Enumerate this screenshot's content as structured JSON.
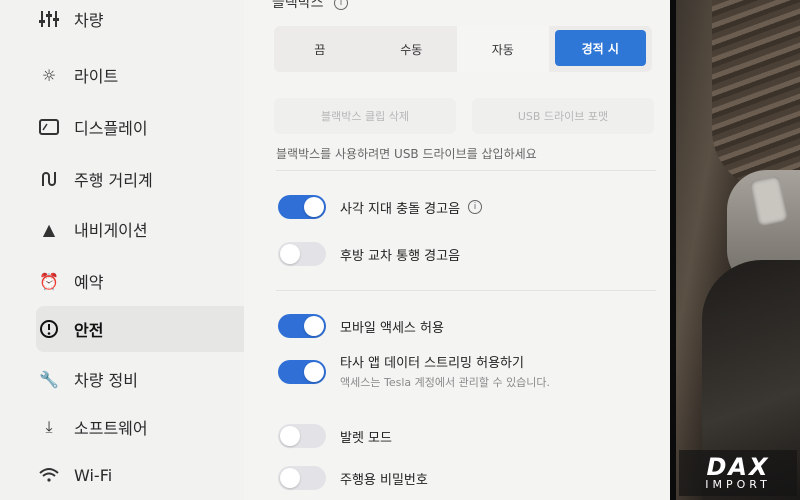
{
  "sidebar": {
    "items": [
      {
        "label": "차량",
        "icon": "sliders-icon"
      },
      {
        "label": "라이트",
        "icon": "sun-icon"
      },
      {
        "label": "디스플레이",
        "icon": "display-icon"
      },
      {
        "label": "주행 거리계",
        "icon": "trip-icon"
      },
      {
        "label": "내비게이션",
        "icon": "navigation-icon"
      },
      {
        "label": "예약",
        "icon": "alarm-clock-icon"
      },
      {
        "label": "안전",
        "icon": "alert-circle-icon"
      },
      {
        "label": "차량 정비",
        "icon": "wrench-icon"
      },
      {
        "label": "소프트웨어",
        "icon": "download-icon"
      },
      {
        "label": "Wi-Fi",
        "icon": "wifi-icon"
      }
    ],
    "active": "안전"
  },
  "dashcam": {
    "title": "블랙박스",
    "options": [
      "끔",
      "수동",
      "자동",
      "경적 시"
    ],
    "selected": "경적 시",
    "delete_clips_label": "블랙박스 클립 삭제",
    "format_usb_label": "USB 드라이브 포맷",
    "hint": "블랙박스를 사용하려면 USB 드라이브를 삽입하세요"
  },
  "toggles": [
    {
      "label": "사각 지대 충돌 경고음",
      "on": true,
      "info": true
    },
    {
      "label": "후방 교차 통행 경고음",
      "on": false
    },
    {
      "label": "모바일 액세스 허용",
      "on": true
    },
    {
      "label": "타사 앱 데이터 스트리밍 허용하기",
      "on": true,
      "sub": "액세스는 Tesla 계정에서 관리할 수 있습니다."
    },
    {
      "label": "발렛 모드",
      "on": false
    },
    {
      "label": "주행용 비밀번호",
      "on": false
    }
  ],
  "watermark": {
    "brand": "DAX",
    "sub": "IMPORT"
  },
  "colors": {
    "accent": "#2f77d6",
    "toggle_off": "#e3e3e7"
  }
}
